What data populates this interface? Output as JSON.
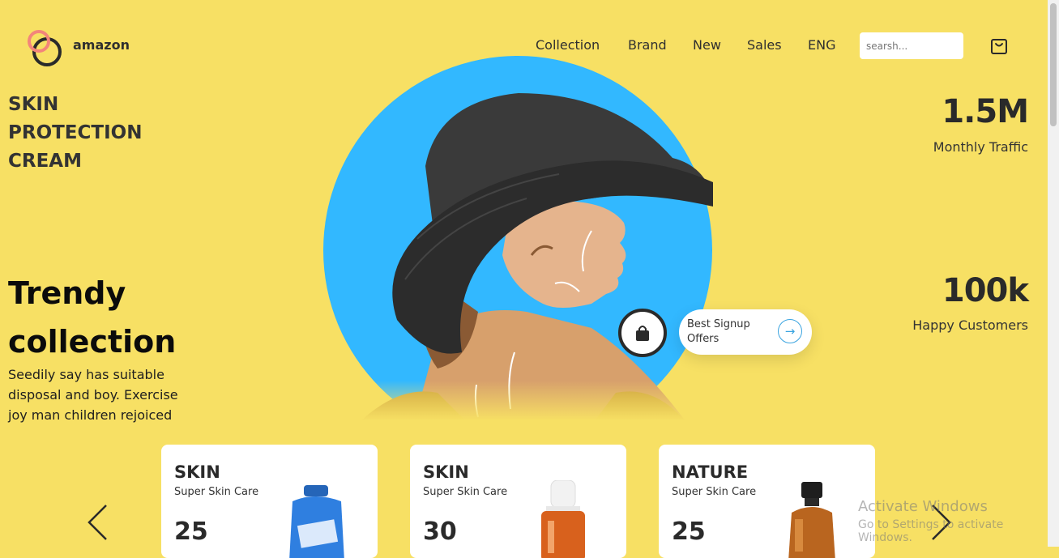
{
  "header": {
    "brand": "amazon",
    "nav": [
      "Collection",
      "Brand",
      "New",
      "Sales",
      "ENG"
    ],
    "search_placeholder": "searsh..."
  },
  "hero": {
    "headline_lines": [
      "SKIN",
      "PROTECTION",
      "CREAM"
    ],
    "trendy_lines": [
      "Trendy",
      "collection"
    ],
    "description": "Seedily say has suitable disposal and boy. Exercise joy man children rejoiced",
    "signup_text": "Best Signup Offers",
    "circle_color": "#32b8ff"
  },
  "stats": [
    {
      "value": "1.5M",
      "label": "Monthly Traffic"
    },
    {
      "value": "100k",
      "label": "Happy Customers"
    }
  ],
  "products": [
    {
      "title": "SKIN",
      "subtitle": "Super Skin Care",
      "price": "25"
    },
    {
      "title": "SKIN",
      "subtitle": "Super Skin Care",
      "price": "30"
    },
    {
      "title": "NATURE",
      "subtitle": "Super Skin Care",
      "price": "25"
    }
  ],
  "watermark": {
    "line1": "Activate Windows",
    "line2": "Go to Settings to activate Windows."
  },
  "colors": {
    "background": "#f7e064",
    "accent_pink": "#f3857a",
    "dark": "#2a2a2a"
  }
}
